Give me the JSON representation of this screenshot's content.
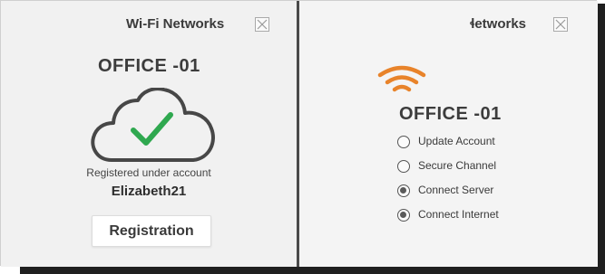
{
  "left_panel": {
    "title": "Wi-Fi Networks",
    "network_name": "OFFICE -01",
    "registered_text": "Registered under account",
    "account_name": "Elizabeth21",
    "registration_button": "Registration",
    "icons": [
      "close-icon",
      "cloud-check-icon"
    ]
  },
  "right_panel": {
    "title": "ɬetworks",
    "network_name": "OFFICE -01",
    "icons": [
      "close-icon",
      "wifi-signal-icon"
    ],
    "options": [
      {
        "label": "Update Account",
        "selected": false
      },
      {
        "label": "Secure Channel",
        "selected": false
      },
      {
        "label": "Connect Server",
        "selected": true
      },
      {
        "label": "Connect Internet",
        "selected": true
      }
    ]
  },
  "colors": {
    "check_green": "#2fa84f",
    "wifi_orange": "#e8832a",
    "divider": "#4a4a4a"
  }
}
